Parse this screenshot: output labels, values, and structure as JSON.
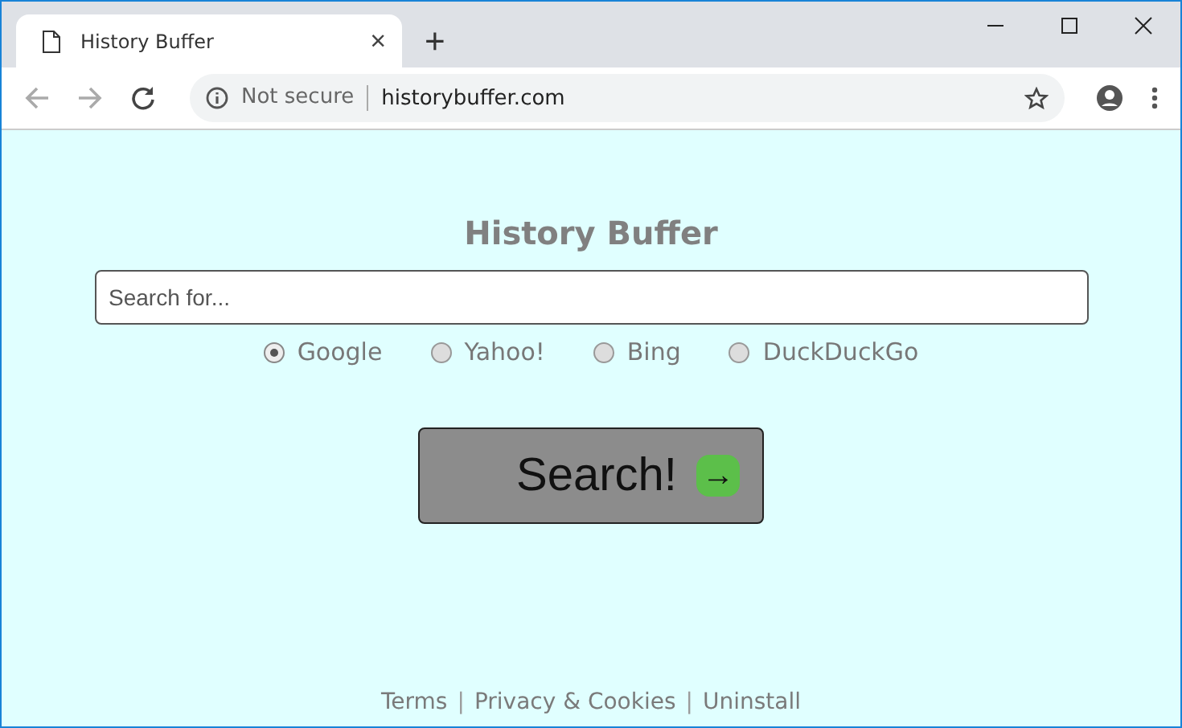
{
  "browser": {
    "tab": {
      "title": "History Buffer",
      "close": "×"
    },
    "new_tab": "+",
    "security": "Not secure",
    "url": "historybuffer.com"
  },
  "page": {
    "title": "History Buffer",
    "search": {
      "placeholder": "Search for..."
    },
    "engines": [
      {
        "label": "Google",
        "selected": true
      },
      {
        "label": "Yahoo!",
        "selected": false
      },
      {
        "label": "Bing",
        "selected": false
      },
      {
        "label": "DuckDuckGo",
        "selected": false
      }
    ],
    "button": {
      "label": "Search!",
      "arrow": "→"
    },
    "footer": [
      {
        "kind": "link",
        "text": "Terms"
      },
      {
        "kind": "separator",
        "text": "|"
      },
      {
        "kind": "link",
        "text": "Privacy & Cookies"
      },
      {
        "kind": "separator",
        "text": "|"
      },
      {
        "kind": "link",
        "text": "Uninstall"
      }
    ]
  }
}
